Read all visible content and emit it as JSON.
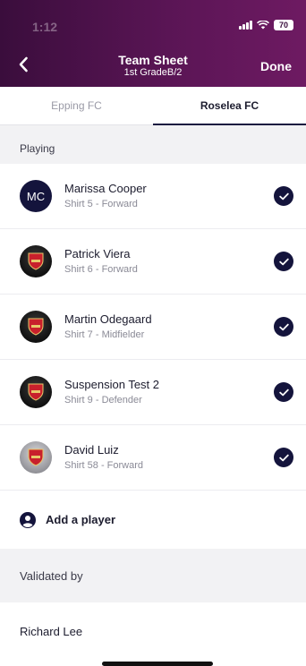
{
  "status_bar": {
    "time": "1:12",
    "battery": "70"
  },
  "header": {
    "title": "Team Sheet",
    "subtitle": "1st GradeB/2",
    "done_label": "Done"
  },
  "tabs": [
    {
      "label": "Epping FC",
      "active": false
    },
    {
      "label": "Roselea FC",
      "active": true
    }
  ],
  "playing": {
    "label": "Playing",
    "players": [
      {
        "name": "Marissa Cooper",
        "meta": "Shirt 5 - Forward",
        "avatar": "MC",
        "avatar_type": "initials",
        "checked": true
      },
      {
        "name": "Patrick Viera",
        "meta": "Shirt 6 - Forward",
        "avatar_type": "crest",
        "checked": true
      },
      {
        "name": "Martin Odegaard",
        "meta": "Shirt 7 - Midfielder",
        "avatar_type": "crest",
        "checked": true
      },
      {
        "name": "Suspension Test 2",
        "meta": "Shirt 9 - Defender",
        "avatar_type": "crest",
        "checked": true
      },
      {
        "name": "David Luiz",
        "meta": "Shirt 58 - Forward",
        "avatar_type": "crest-light",
        "checked": true
      }
    ],
    "add_label": "Add a player"
  },
  "validation": {
    "label": "Validated by",
    "name": "Richard Lee"
  },
  "colors": {
    "header_start": "#3a0d3c",
    "header_end": "#6e1a62",
    "accent": "#14143c"
  }
}
